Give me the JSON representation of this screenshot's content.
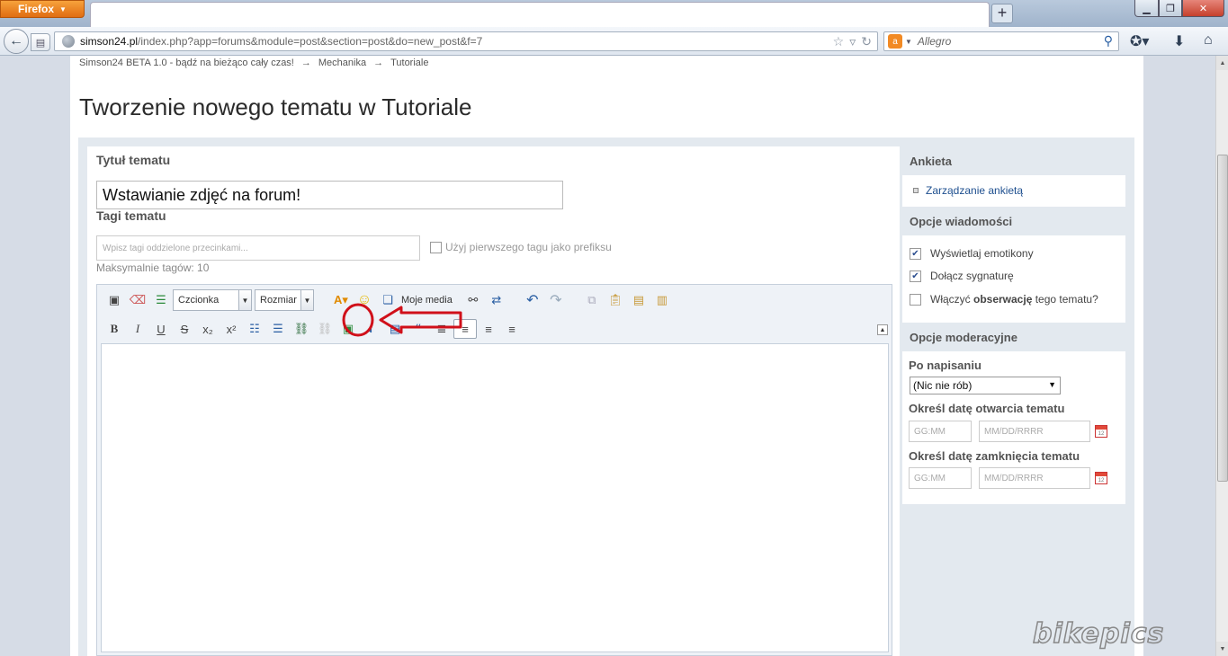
{
  "browser": {
    "app_button": "Firefox",
    "url_domain": "simson24.pl",
    "url_path": "/index.php?app=forums&module=post&section=post&do=new_post&f=7",
    "search_placeholder": "Allegro"
  },
  "breadcrumb": [
    "Simson24 BETA 1.0 - bądź na bieżąco cały czas!",
    "Mechanika",
    "Tutoriale"
  ],
  "breadcrumb_sep": "→",
  "page_title": "Tworzenie nowego tematu w Tutoriale",
  "form": {
    "title_label": "Tytuł tematu",
    "title_value": "Wstawianie zdjęć na forum!",
    "tags_label": "Tagi tematu",
    "tags_placeholder": "Wpisz tagi oddzielone przecinkami...",
    "prefix_label": "Użyj pierwszego tagu jako prefiksu",
    "max_tags": "Maksymalnie tagów: 10"
  },
  "editor": {
    "font_select": "Czcionka",
    "size_select": "Rozmiar",
    "media_label": "Moje media"
  },
  "sidebar": {
    "poll_header": "Ankieta",
    "poll_link": "Zarządzanie ankietą",
    "msg_header": "Opcje wiadomości",
    "opt_emoticons": "Wyświetlaj emotikony",
    "opt_signature": "Dołącz sygnaturę",
    "opt_watch_pre": "Włączyć ",
    "opt_watch_bold": "obserwację",
    "opt_watch_post": " tego tematu?",
    "mod_header": "Opcje moderacyjne",
    "after_post_label": "Po napisaniu",
    "after_post_value": "(Nic nie rób)",
    "open_date_label": "Określ datę otwarcia tematu",
    "close_date_label": "Określ datę zamknięcia tematu",
    "time_placeholder": "GG:MM",
    "date_placeholder": "MM/DD/RRRR"
  },
  "colors": {
    "annotation": "#d0101a",
    "link": "#1e4f8f",
    "panel": "#e3e9ef"
  },
  "watermark": "bikepics"
}
